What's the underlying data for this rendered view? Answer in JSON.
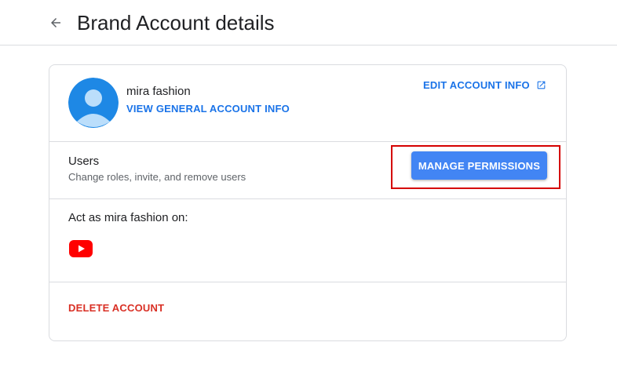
{
  "header": {
    "back_icon": "arrow-left-icon",
    "title": "Brand Account details"
  },
  "account": {
    "name": "mira fashion",
    "avatar_icon": "person-avatar-icon",
    "view_info_label": "VIEW GENERAL ACCOUNT INFO",
    "edit_info_label": "EDIT ACCOUNT INFO",
    "edit_info_icon": "open-in-new-icon"
  },
  "users": {
    "title": "Users",
    "description": "Change roles, invite, and remove users",
    "manage_label": "MANAGE PERMISSIONS"
  },
  "act_as": {
    "label": "Act as mira fashion on:",
    "service_icon": "youtube-icon"
  },
  "danger": {
    "delete_label": "DELETE ACCOUNT"
  },
  "colors": {
    "link": "#1a73e8",
    "button": "#4285f4",
    "danger": "#d93025",
    "highlight": "#d50000",
    "avatar": "#1e88e5",
    "youtube": "#ff0000"
  }
}
